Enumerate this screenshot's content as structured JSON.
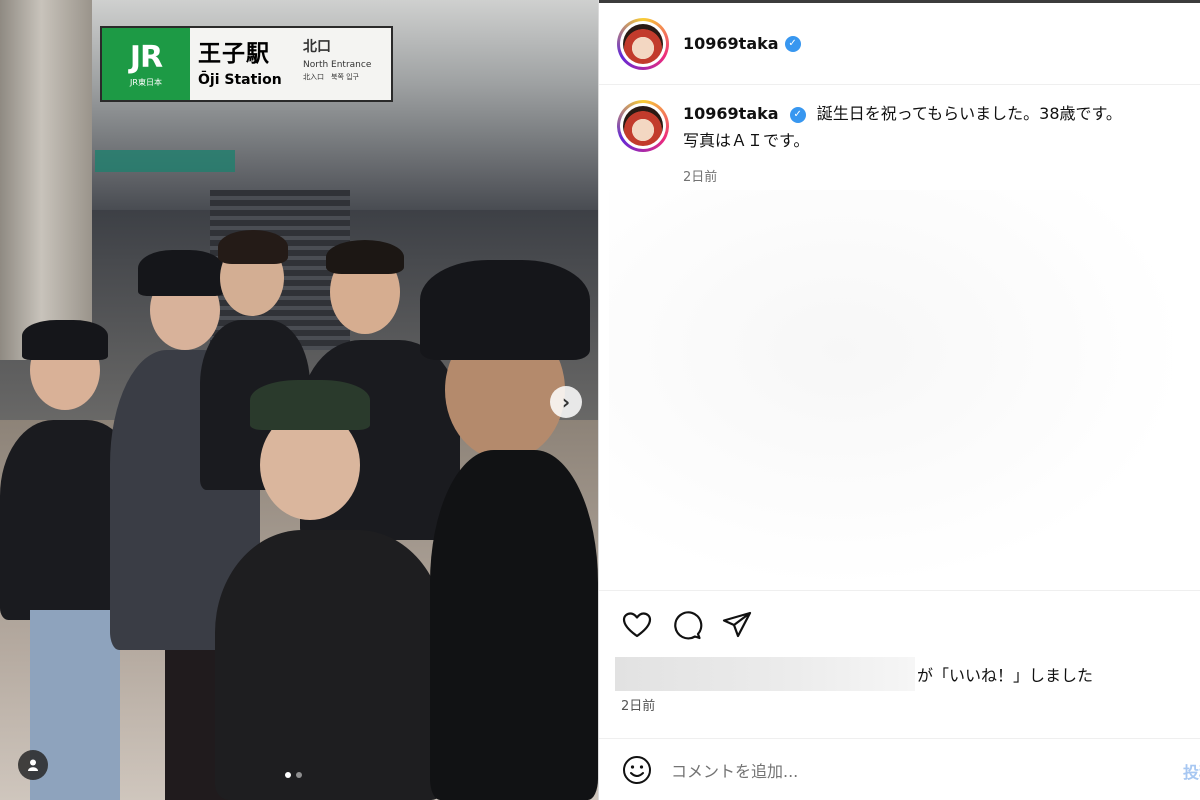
{
  "photo": {
    "sign": {
      "jr_mark": "JR",
      "jr_sub": "JR東日本",
      "station_ja": "王子駅",
      "station_en": "Ōji Station",
      "exit_ja": "北口",
      "exit_en": "North Entrance",
      "exit_multi": "北入口　북쪽 입구"
    },
    "carousel_next": "›",
    "dots_count": 2,
    "active_dot": 0
  },
  "post": {
    "username": "10969taka",
    "verified": true,
    "caption_line1": "誕生日を祝ってもらいました。38歳です。",
    "caption_line2": "写真はＡＩです。",
    "caption_time": "2日前",
    "liked_by_suffix": "が「いいね！」しました",
    "likes_time": "2日前",
    "comment_placeholder": "コメントを追加...",
    "post_button": "投稿"
  },
  "colors": {
    "jr_green": "#1d9a45",
    "verified_blue": "#3897f0",
    "post_button_disabled": "#a7c7f2"
  }
}
